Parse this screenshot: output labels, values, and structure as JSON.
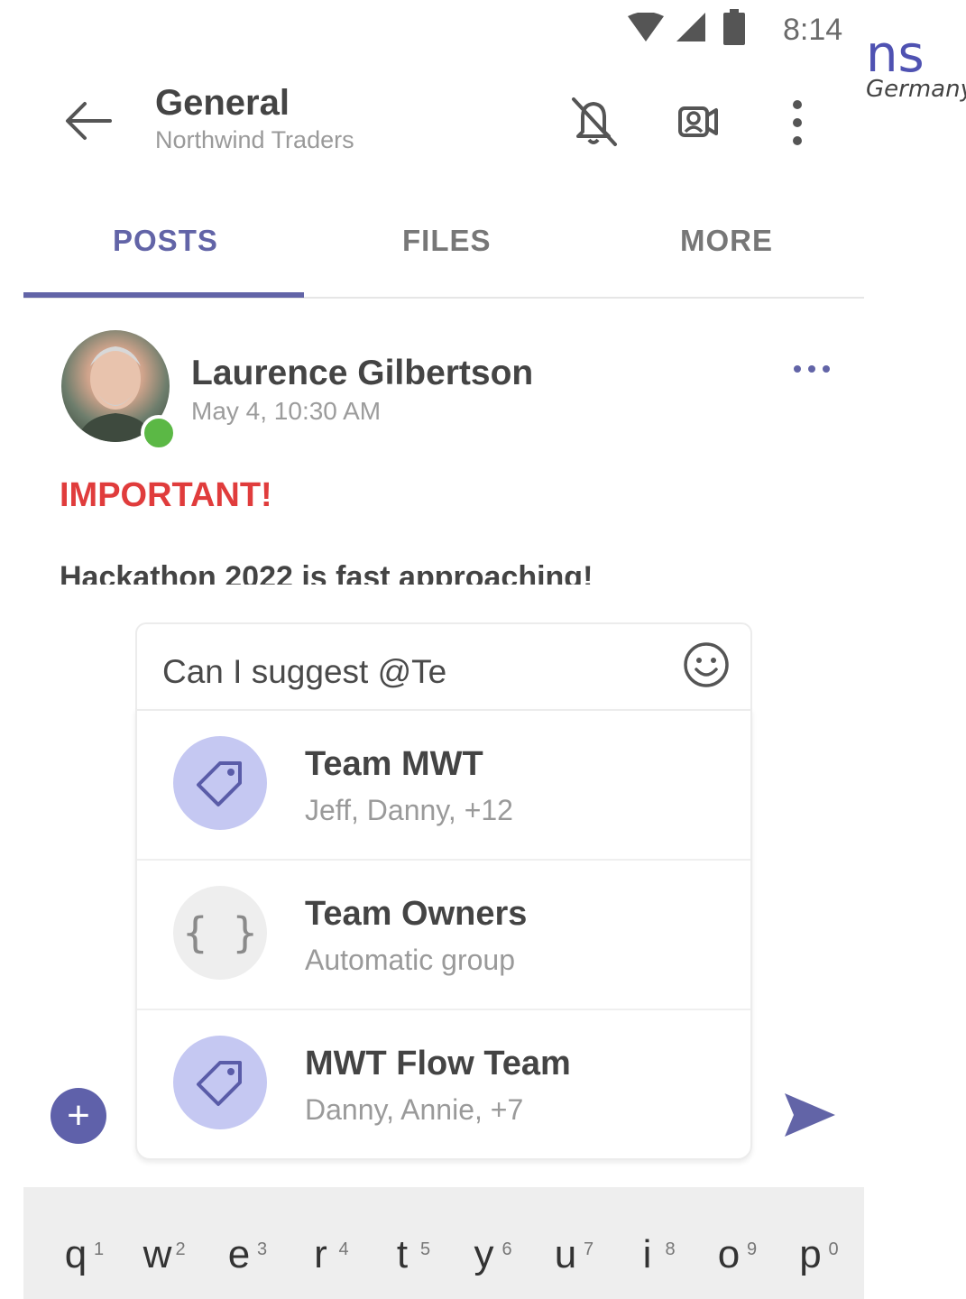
{
  "status_bar": {
    "time": "8:14"
  },
  "watermark": {
    "text_a": "ns",
    "text_b": "Germany"
  },
  "header": {
    "title": "General",
    "subtitle": "Northwind Traders",
    "icons": [
      "back-arrow-icon",
      "bell-off-icon",
      "meet-now-icon",
      "more-vertical-icon"
    ]
  },
  "tabs": [
    {
      "label": "POSTS",
      "active": true
    },
    {
      "label": "FILES",
      "active": false
    },
    {
      "label": "MORE",
      "active": false
    }
  ],
  "post": {
    "author": "Laurence Gilbertson",
    "time": "May 4, 10:30 AM",
    "important": "IMPORTANT!",
    "body": "Hackathon 2022 is fast approaching!"
  },
  "compose": {
    "text": "Can I suggest @Te"
  },
  "suggestions": [
    {
      "name": "Team MWT",
      "meta": "Jeff, Danny, +12",
      "icon": "tag-icon"
    },
    {
      "name": "Team Owners",
      "meta": "Automatic group",
      "icon": "braces-icon"
    },
    {
      "name": "MWT Flow Team",
      "meta": "Danny, Annie, +7",
      "icon": "tag-icon"
    }
  ],
  "group_icon_glyph": "{ }",
  "add_button": "+",
  "colors": {
    "accent": "#6264a7",
    "important": "#e03c3c",
    "presence": "#5bb845",
    "tag_circle": "#c5c8f2"
  },
  "keyboard": {
    "keys": [
      "q",
      "w",
      "e",
      "r",
      "t",
      "y",
      "u",
      "i",
      "o",
      "p"
    ],
    "numbers": [
      "1",
      "2",
      "3",
      "4",
      "5",
      "6",
      "7",
      "8",
      "9",
      "0"
    ]
  }
}
